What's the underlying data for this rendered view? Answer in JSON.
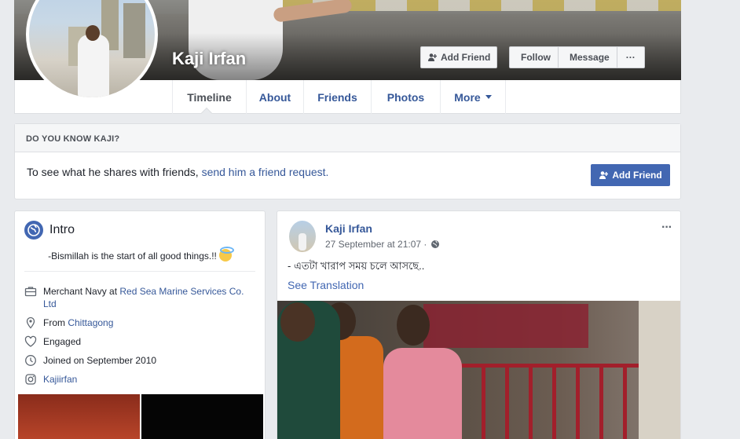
{
  "profile": {
    "name": "Kaji Irfan"
  },
  "cover_buttons": {
    "add_friend": "Add Friend",
    "follow": "Follow",
    "message": "Message",
    "more": "···"
  },
  "nav": {
    "tabs": [
      "Timeline",
      "About",
      "Friends",
      "Photos",
      "More"
    ]
  },
  "know_box": {
    "heading": "DO YOU KNOW KAJI?",
    "text_prefix": "To see what he shares with friends, ",
    "link": "send him a friend request.",
    "button": "Add Friend"
  },
  "intro": {
    "title": "Intro",
    "bio": "-Bismillah is the start of all good things.!!",
    "work_prefix": "Merchant Navy at ",
    "work_link": "Red Sea Marine Services Co. Ltd",
    "from_prefix": "From ",
    "from_link": "Chittagong",
    "relationship": "Engaged",
    "joined": "Joined on September 2010",
    "instagram": "Kajiirfan"
  },
  "post": {
    "author": "Kaji Irfan",
    "time": "27 September at 21:07 ·",
    "text": "- এতটা খারাপ সময় চলে আসছে..",
    "translate": "See Translation",
    "menu": "···"
  }
}
